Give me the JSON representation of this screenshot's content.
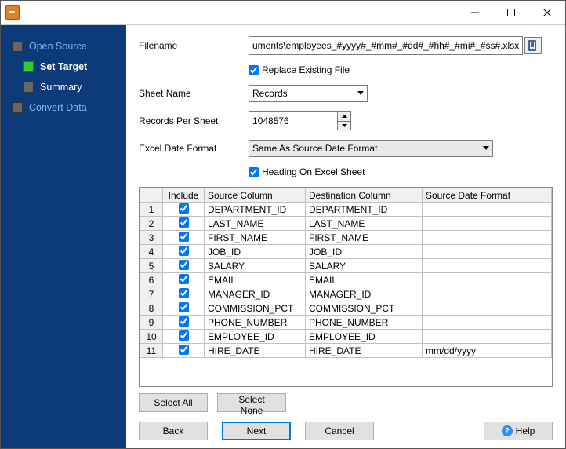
{
  "sidebar": {
    "steps": [
      {
        "label": "Open Source"
      },
      {
        "label": "Set Target"
      },
      {
        "label": "Summary"
      },
      {
        "label": "Convert Data"
      }
    ]
  },
  "form": {
    "filename_label": "Filename",
    "filename_value": "uments\\employees_#yyyy#_#mm#_#dd#_#hh#_#mi#_#ss#.xlsx",
    "replace_label": "Replace Existing File",
    "sheetname_label": "Sheet Name",
    "sheetname_value": "Records",
    "records_label": "Records Per Sheet",
    "records_value": "1048576",
    "dateformat_label": "Excel Date Format",
    "dateformat_value": "Same As Source Date Format",
    "heading_label": "Heading On Excel Sheet"
  },
  "table": {
    "headers": {
      "include": "Include",
      "source": "Source Column",
      "dest": "Destination Column",
      "format": "Source Date Format"
    },
    "rows": [
      {
        "n": "1",
        "src": "DEPARTMENT_ID",
        "dst": "DEPARTMENT_ID",
        "fmt": ""
      },
      {
        "n": "2",
        "src": "LAST_NAME",
        "dst": "LAST_NAME",
        "fmt": ""
      },
      {
        "n": "3",
        "src": "FIRST_NAME",
        "dst": "FIRST_NAME",
        "fmt": ""
      },
      {
        "n": "4",
        "src": "JOB_ID",
        "dst": "JOB_ID",
        "fmt": ""
      },
      {
        "n": "5",
        "src": "SALARY",
        "dst": "SALARY",
        "fmt": ""
      },
      {
        "n": "6",
        "src": "EMAIL",
        "dst": "EMAIL",
        "fmt": ""
      },
      {
        "n": "7",
        "src": "MANAGER_ID",
        "dst": "MANAGER_ID",
        "fmt": ""
      },
      {
        "n": "8",
        "src": "COMMISSION_PCT",
        "dst": "COMMISSION_PCT",
        "fmt": ""
      },
      {
        "n": "9",
        "src": "PHONE_NUMBER",
        "dst": "PHONE_NUMBER",
        "fmt": ""
      },
      {
        "n": "10",
        "src": "EMPLOYEE_ID",
        "dst": "EMPLOYEE_ID",
        "fmt": ""
      },
      {
        "n": "11",
        "src": "HIRE_DATE",
        "dst": "HIRE_DATE",
        "fmt": "mm/dd/yyyy"
      }
    ]
  },
  "buttons": {
    "select_all": "Select All",
    "select_none": "Select None",
    "back": "Back",
    "next": "Next",
    "cancel": "Cancel",
    "help": "Help"
  }
}
